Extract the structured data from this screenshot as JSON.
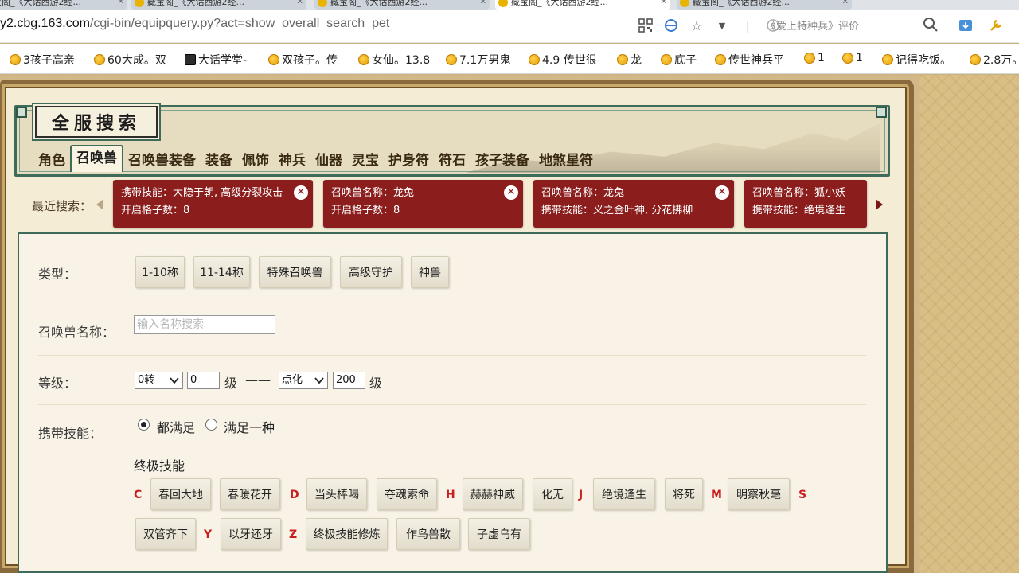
{
  "browser": {
    "tabs": [
      {
        "label": "藏宝阁_《大话西游2经..."
      },
      {
        "label": "藏宝阁_《大话西游2经..."
      },
      {
        "label": "藏宝阁_《大话西游2经..."
      },
      {
        "label": "藏宝阁_《大话西游2经..."
      },
      {
        "label": "藏宝阁_《大话西游2经..."
      }
    ],
    "url_host": "y2.cbg.163.com",
    "url_path": "/cgi-bin/equipquery.py?act=show_overall_search_pet",
    "search_hint": "《爱上特种兵》评价",
    "bookmarks": [
      {
        "label": "3孩子高亲"
      },
      {
        "label": "60大成。双"
      },
      {
        "label": "大话学堂-"
      },
      {
        "label": "双孩子。传"
      },
      {
        "label": "女仙。13.8"
      },
      {
        "label": "7.1万男鬼"
      },
      {
        "label": "4.9 传世很"
      },
      {
        "label": "龙"
      },
      {
        "label": "底子"
      },
      {
        "label": "传世神兵平"
      },
      {
        "label": "1"
      },
      {
        "label": "1"
      },
      {
        "label": "记得吃饭。"
      },
      {
        "label": "2.8万。"
      }
    ]
  },
  "page": {
    "title": "全服搜索",
    "tabs": [
      {
        "label": "角色"
      },
      {
        "label": "召唤兽"
      },
      {
        "label": "召唤兽装备"
      },
      {
        "label": "装备"
      },
      {
        "label": "佩饰"
      },
      {
        "label": "神兵"
      },
      {
        "label": "仙器"
      },
      {
        "label": "灵宝"
      },
      {
        "label": "护身符"
      },
      {
        "label": "符石"
      },
      {
        "label": "孩子装备"
      },
      {
        "label": "地煞星符"
      }
    ],
    "active_tab": "召唤兽",
    "recent_label": "最近搜索：",
    "recent": [
      {
        "line1": "携带技能：大隐于朝, 高级分裂攻击",
        "line2": "开启格子数：8"
      },
      {
        "line1": "召唤兽名称：龙兔",
        "line2": "开启格子数：8"
      },
      {
        "line1": "召唤兽名称：龙兔",
        "line2": "携带技能：义之金叶神, 分花拂柳"
      },
      {
        "line1": "召唤兽名称：狐小妖",
        "line2": "携带技能：绝境逢生"
      }
    ],
    "close_glyph": "✕"
  },
  "form": {
    "type_label": "类型：",
    "type_buttons": [
      {
        "label": "1-10称"
      },
      {
        "label": "11-14称"
      },
      {
        "label": "特殊召唤兽"
      },
      {
        "label": "高级守护"
      },
      {
        "label": "神兽"
      }
    ],
    "name_label": "召唤兽名称：",
    "name_placeholder": "输入名称搜索",
    "level_label": "等级：",
    "level_from_select": "0转",
    "level_from_value": "0",
    "level_unit": "级",
    "level_sep": "——",
    "level_to_select": "点化",
    "level_to_value": "200",
    "skills_label": "携带技能：",
    "radio_all": "都满足",
    "radio_any": "满足一种",
    "ultimate_title": "终极技能",
    "letters": [
      "C",
      "D",
      "H",
      "J",
      "M",
      "S",
      "Y",
      "Z"
    ],
    "skills_row1": [
      {
        "label": "春回大地"
      },
      {
        "label": "春暖花开"
      },
      {
        "label": "当头棒喝"
      },
      {
        "label": "夺魂索命"
      },
      {
        "label": "赫赫神威"
      },
      {
        "label": "化无"
      },
      {
        "label": "绝境逢生"
      },
      {
        "label": "将死"
      },
      {
        "label": "明察秋毫"
      }
    ],
    "skills_row2": [
      {
        "label": "双管齐下"
      },
      {
        "label": "以牙还牙"
      },
      {
        "label": "终极技能修炼"
      },
      {
        "label": "作鸟兽散"
      },
      {
        "label": "子虚乌有"
      }
    ]
  }
}
